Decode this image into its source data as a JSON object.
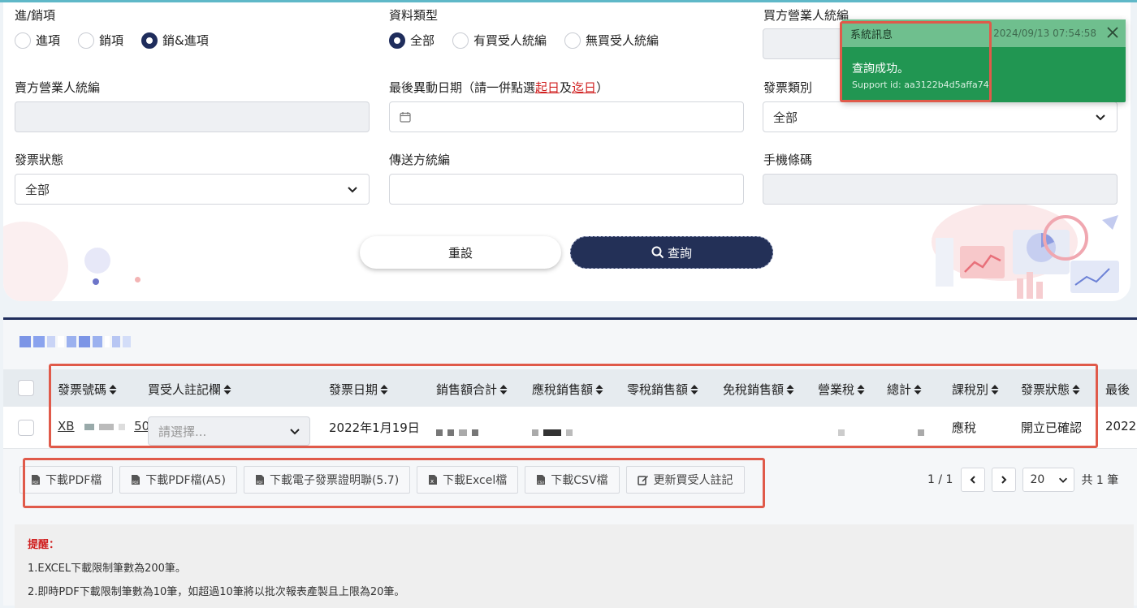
{
  "filters": {
    "io_type": {
      "label": "進/銷項",
      "options": [
        "進項",
        "銷項",
        "銷&進項"
      ],
      "selected": 2
    },
    "data_type": {
      "label": "資料類型",
      "options": [
        "全部",
        "有買受人統編",
        "無買受人統編"
      ],
      "selected": 0
    },
    "buyer_id": {
      "label": "買方營業人統編"
    },
    "seller_id": {
      "label": "賣方營業人統編"
    },
    "last_change_date": {
      "label_prefix": "最後異動日期（請一併點選",
      "start": "起日",
      "and": "及",
      "end": "迄日",
      "suffix": "）"
    },
    "invoice_category": {
      "label": "發票類別",
      "value": "全部"
    },
    "invoice_status": {
      "label": "發票狀態",
      "value": "全部"
    },
    "sender_id": {
      "label": "傳送方統編"
    },
    "mobile_barcode": {
      "label": "手機條碼"
    }
  },
  "buttons": {
    "reset": "重設",
    "query": "查詢"
  },
  "toast": {
    "title": "系統訊息",
    "time": "2024/09/13 07:54:58",
    "message": "查詢成功。",
    "support_id": "Support id: aa3122b4d5affa74"
  },
  "table": {
    "columns": [
      "發票號碼",
      "買受人註記欄",
      "發票日期",
      "銷售額合計",
      "應稅銷售額",
      "零稅銷售額",
      "免稅銷售額",
      "營業稅",
      "總計",
      "課稅別",
      "發票狀態",
      "最後"
    ],
    "row": {
      "invoice_no_prefix": "XB",
      "invoice_no_suffix": "50",
      "buyer_note_placeholder": "請選擇...",
      "invoice_date": "2022年1月19日",
      "tax_type": "應稅",
      "status": "開立已確認",
      "last": "2022"
    }
  },
  "actions": [
    "下載PDF檔",
    "下載PDF檔(A5)",
    "下載電子發票證明聯(5.7)",
    "下載Excel檔",
    "下載CSV檔",
    "更新買受人註記"
  ],
  "pager": {
    "page": "1 / 1",
    "page_size": "20",
    "total": "共 1 筆"
  },
  "reminder": {
    "title": "提醒：",
    "lines": [
      "1.EXCEL下載限制筆數為200筆。",
      "2.即時PDF下載限制筆數為10筆，如超過10筆將以批次報表產製且上限為20筆。"
    ]
  },
  "colors": {
    "navy": "#233057",
    "toast_green": "#219652",
    "highlight_red": "#e05a4a"
  }
}
